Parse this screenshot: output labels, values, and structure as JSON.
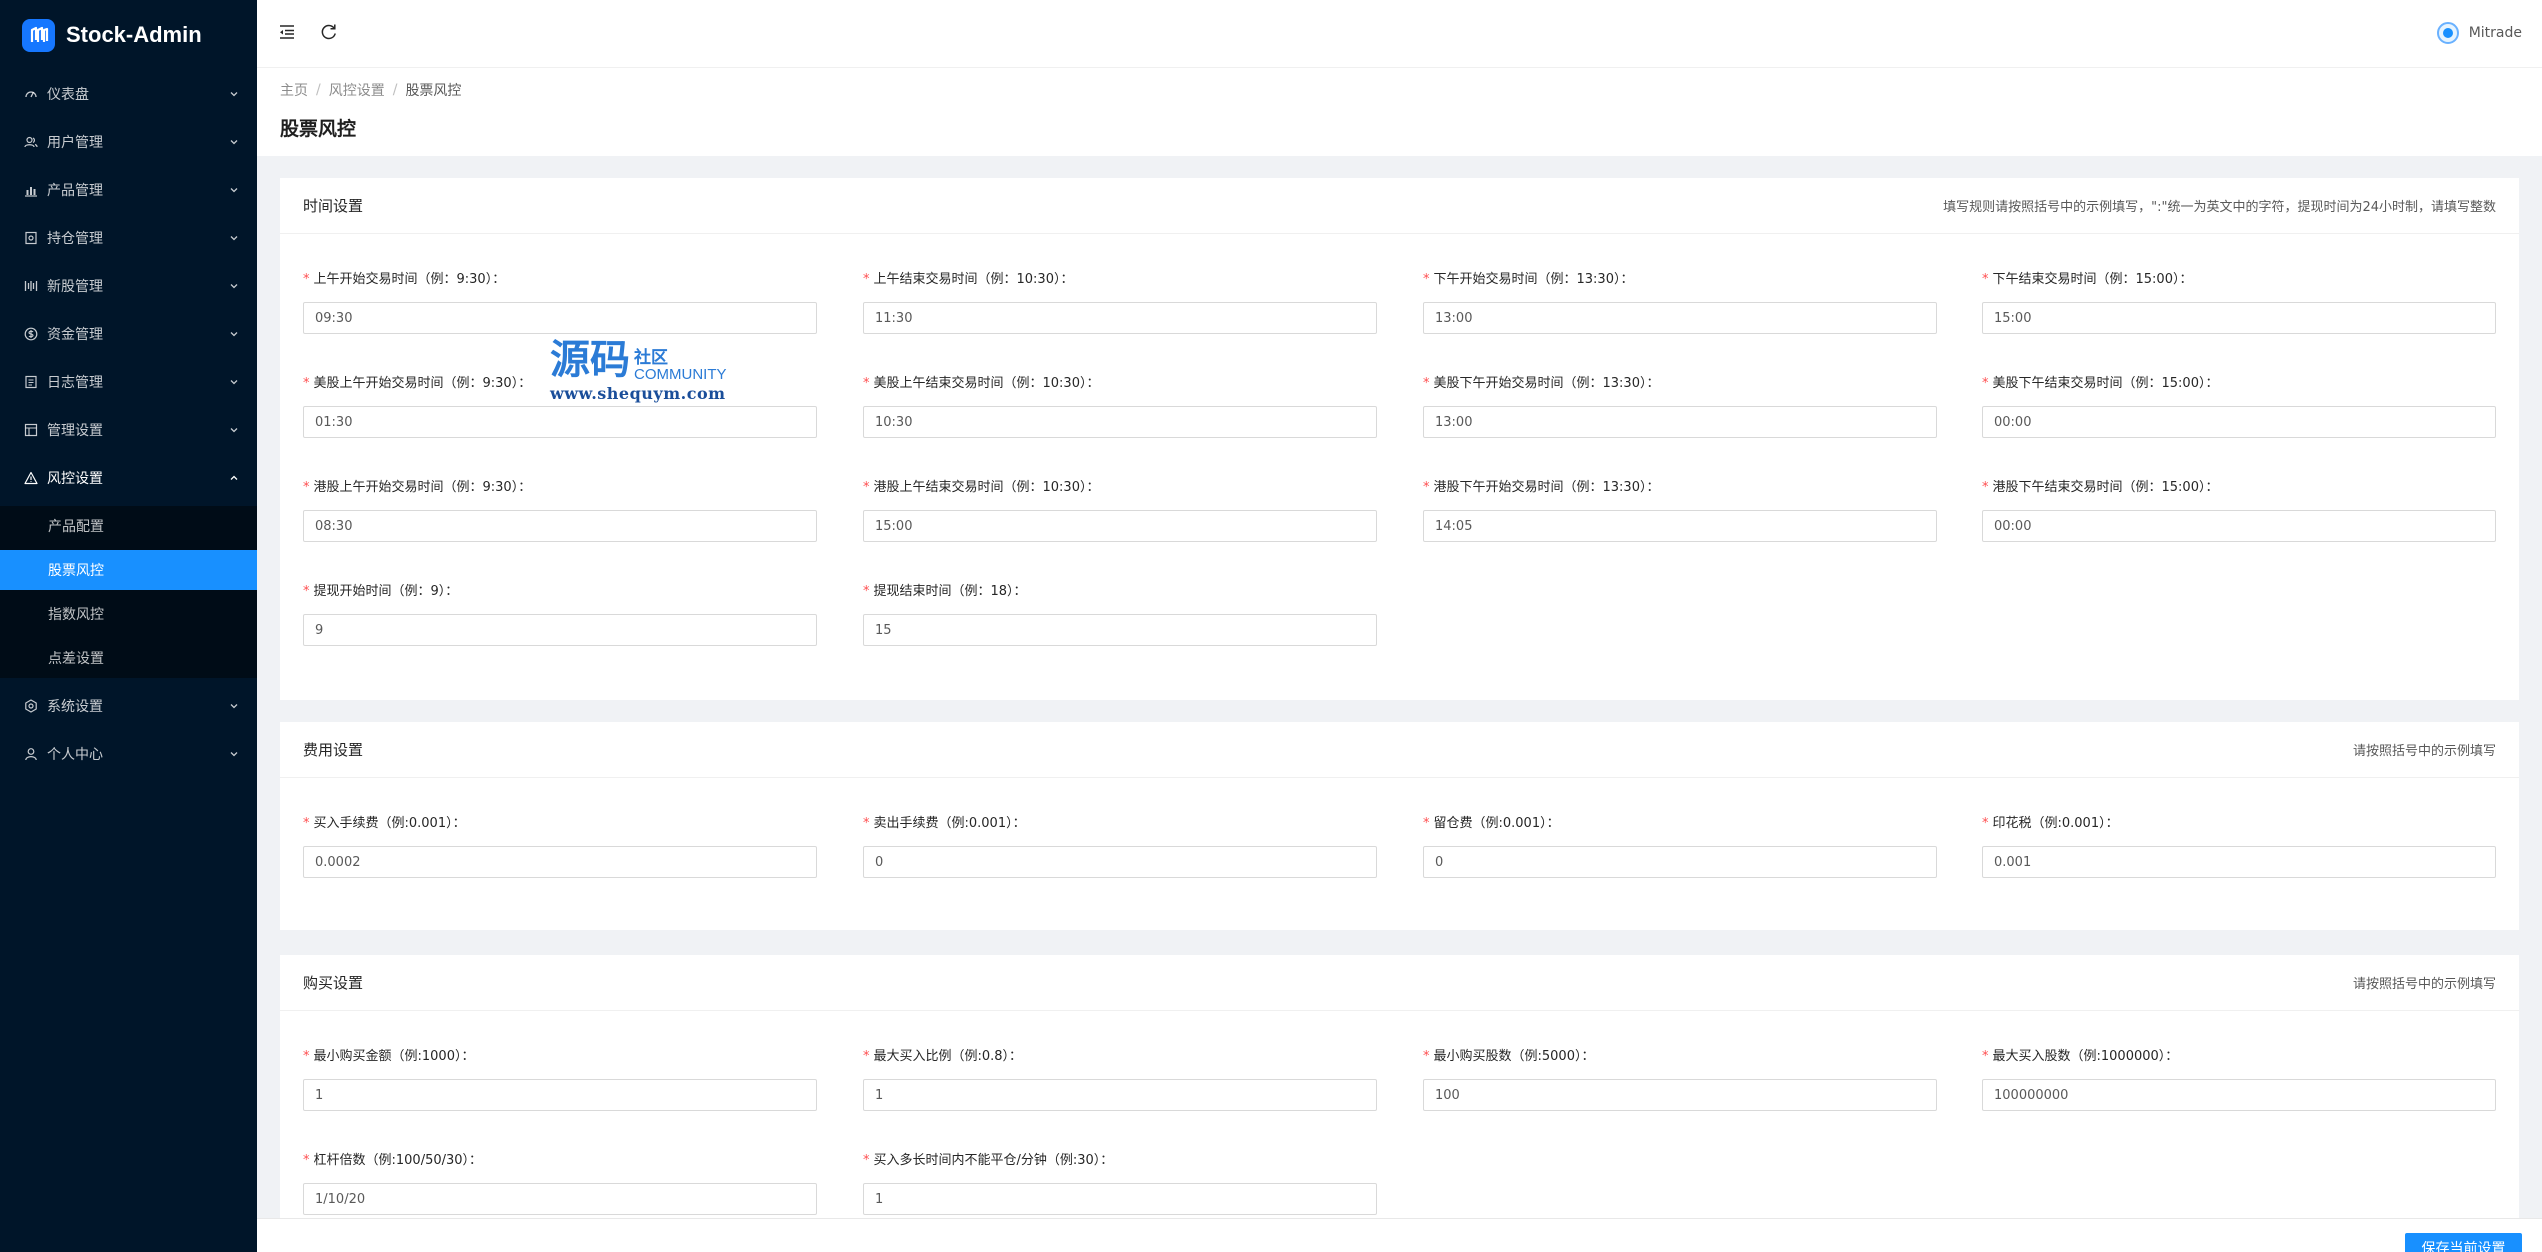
{
  "app": {
    "logo_text": "Stock-Admin"
  },
  "sidebar": {
    "items": [
      {
        "label": "仪表盘",
        "icon": "dashboard-icon"
      },
      {
        "label": "用户管理",
        "icon": "user-group-icon"
      },
      {
        "label": "产品管理",
        "icon": "chart-icon"
      },
      {
        "label": "持仓管理",
        "icon": "position-icon"
      },
      {
        "label": "新股管理",
        "icon": "new-stock-icon"
      },
      {
        "label": "资金管理",
        "icon": "money-icon"
      },
      {
        "label": "日志管理",
        "icon": "log-icon"
      },
      {
        "label": "管理设置",
        "icon": "admin-settings-icon"
      },
      {
        "label": "风控设置",
        "icon": "warning-icon"
      },
      {
        "label": "系统设置",
        "icon": "gear-icon"
      },
      {
        "label": "个人中心",
        "icon": "person-icon"
      }
    ],
    "risk_submenu": [
      {
        "label": "产品配置"
      },
      {
        "label": "股票风控"
      },
      {
        "label": "指数风控"
      },
      {
        "label": "点差设置"
      }
    ],
    "active_color": "#1890ff"
  },
  "header": {
    "user_name": "Mitrade"
  },
  "breadcrumb": {
    "home": "主页",
    "parent": "风控设置",
    "current": "股票风控",
    "separator": "/"
  },
  "page_title": "股票风控",
  "time_settings": {
    "title": "时间设置",
    "hint": "填写规则请按照括号中的示例填写，\":\"统一为英文中的字符，提现时间为24小时制，请填写整数",
    "fields": [
      {
        "label": "上午开始交易时间（例：9:30）：",
        "value": "09:30"
      },
      {
        "label": "上午结束交易时间（例：10:30）：",
        "value": "11:30"
      },
      {
        "label": "下午开始交易时间（例：13:30）：",
        "value": "13:00"
      },
      {
        "label": "下午结束交易时间（例：15:00）：",
        "value": "15:00"
      },
      {
        "label": "美股上午开始交易时间（例：9:30）：",
        "value": "01:30"
      },
      {
        "label": "美股上午结束交易时间（例：10:30）：",
        "value": "10:30"
      },
      {
        "label": "美股下午开始交易时间（例：13:30）：",
        "value": "13:00"
      },
      {
        "label": "美股下午结束交易时间（例：15:00）：",
        "value": "00:00"
      },
      {
        "label": "港股上午开始交易时间（例：9:30）：",
        "value": "08:30"
      },
      {
        "label": "港股上午结束交易时间（例：10:30）：",
        "value": "15:00"
      },
      {
        "label": "港股下午开始交易时间（例：13:30）：",
        "value": "14:05"
      },
      {
        "label": "港股下午结束交易时间（例：15:00）：",
        "value": "00:00"
      },
      {
        "label": "提现开始时间（例：9）：",
        "value": "9"
      },
      {
        "label": "提现结束时间（例：18）：",
        "value": "15"
      }
    ]
  },
  "fee_settings": {
    "title": "费用设置",
    "hint": "请按照括号中的示例填写",
    "fields": [
      {
        "label": "买入手续费（例:0.001）：",
        "value": "0.0002"
      },
      {
        "label": "卖出手续费（例:0.001）：",
        "value": "0"
      },
      {
        "label": "留仓费（例:0.001）：",
        "value": "0"
      },
      {
        "label": "印花税（例:0.001）：",
        "value": "0.001"
      }
    ]
  },
  "buy_settings": {
    "title": "购买设置",
    "hint": "请按照括号中的示例填写",
    "fields": [
      {
        "label": "最小购买金额（例:1000）：",
        "value": "1"
      },
      {
        "label": "最大买入比例（例:0.8）：",
        "value": "1"
      },
      {
        "label": "最小购买股数（例:5000）：",
        "value": "100"
      },
      {
        "label": "最大买入股数（例:1000000）：",
        "value": "100000000"
      },
      {
        "label": "杠杆倍数（例:100/50/30）：",
        "value": "1/10/20"
      },
      {
        "label": "买入多长时间内不能平仓/分钟（例:30）：",
        "value": "1"
      }
    ]
  },
  "watermark": {
    "big": "源码",
    "cn": "社区",
    "en": "COMMUNITY",
    "url": "www.shequym.com"
  },
  "footer": {
    "save_label": "保存当前设置"
  }
}
